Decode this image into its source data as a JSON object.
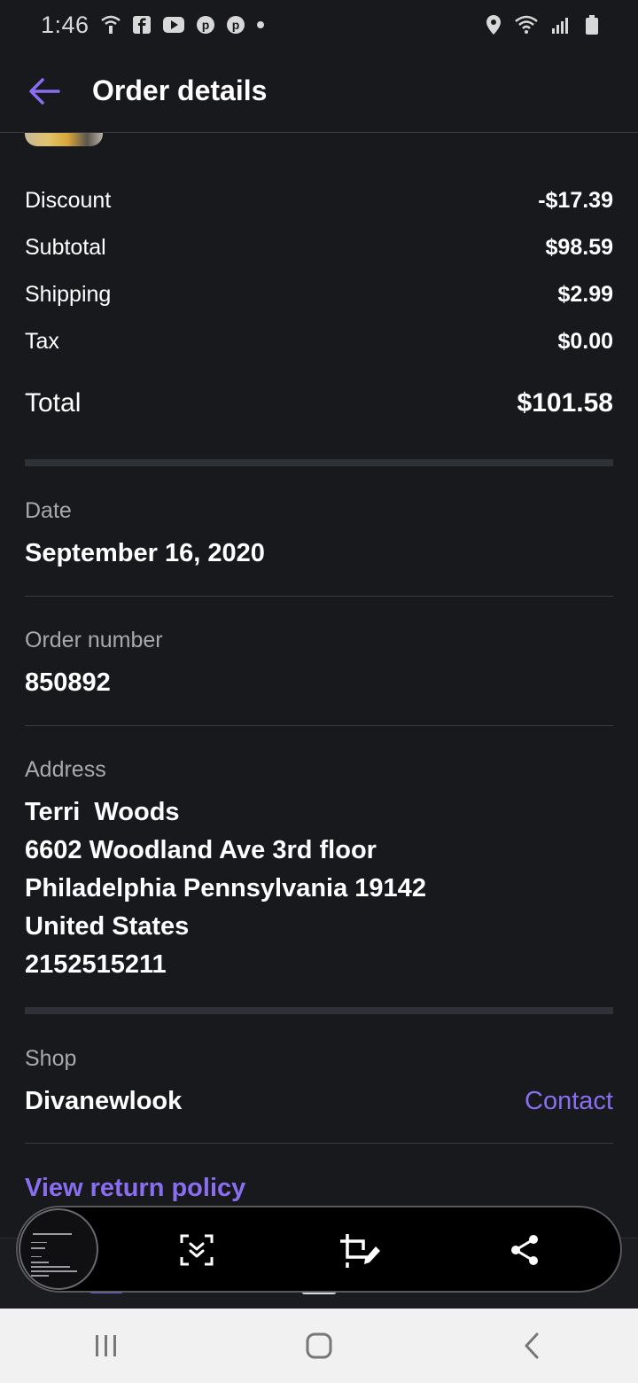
{
  "status_bar": {
    "time": "1:46",
    "left_icons": [
      "hotspot-icon",
      "facebook-icon",
      "youtube-icon",
      "pinterest-icon",
      "pinterest-icon",
      "dot-icon"
    ],
    "right_icons": [
      "location-icon",
      "wifi-icon",
      "signal-icon",
      "battery-icon"
    ]
  },
  "header": {
    "title": "Order details",
    "back_icon": "arrow-left-icon",
    "accent_color": "#8a6ef0"
  },
  "summary": [
    {
      "label": "Discount",
      "value": "-$17.39"
    },
    {
      "label": "Subtotal",
      "value": "$98.59"
    },
    {
      "label": "Shipping",
      "value": "$2.99"
    },
    {
      "label": "Tax",
      "value": "$0.00"
    }
  ],
  "total": {
    "label": "Total",
    "value": "$101.58"
  },
  "date": {
    "label": "Date",
    "value": "September 16, 2020"
  },
  "order_number": {
    "label": "Order number",
    "value": "850892"
  },
  "address": {
    "label": "Address",
    "lines": [
      "Terri  Woods",
      "6602 Woodland Ave 3rd floor",
      "Philadelphia Pennsylvania 19142",
      "United States",
      "2152515211"
    ]
  },
  "shop": {
    "label": "Shop",
    "name": "Divanewlook",
    "contact_label": "Contact"
  },
  "return_policy_label": "View return policy",
  "screenshot_toolbar": {
    "buttons": [
      "scroll-capture-icon",
      "crop-edit-icon",
      "share-icon"
    ]
  },
  "nav_bar": {
    "buttons": [
      "recents-icon",
      "home-icon",
      "back-icon"
    ]
  }
}
